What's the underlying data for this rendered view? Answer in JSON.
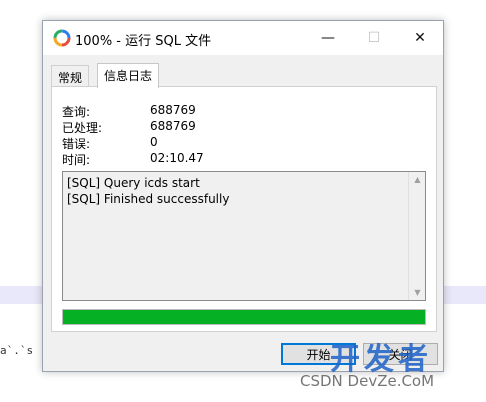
{
  "background": {
    "code_fragment": "a`.`s"
  },
  "window": {
    "title": "100% - 运行 SQL 文件",
    "controls": {
      "minimize": "—",
      "maximize": "☐",
      "close": "✕"
    }
  },
  "tabs": [
    {
      "label": "常规"
    },
    {
      "label": "信息日志"
    }
  ],
  "stats": {
    "query_label": "查询:",
    "query_value": "688769",
    "processed_label": "已处理:",
    "processed_value": "688769",
    "errors_label": "错误:",
    "errors_value": "0",
    "time_label": "时间:",
    "time_value": "02:10.47"
  },
  "log": {
    "lines": [
      "[SQL] Query icds start",
      "[SQL] Finished successfully"
    ]
  },
  "progress": {
    "percent": 100,
    "color": "#06b025"
  },
  "buttons": {
    "start": "开始",
    "close": "关闭"
  },
  "watermark": {
    "big": "开发者",
    "small": "CSDN DevZe.CoM"
  }
}
